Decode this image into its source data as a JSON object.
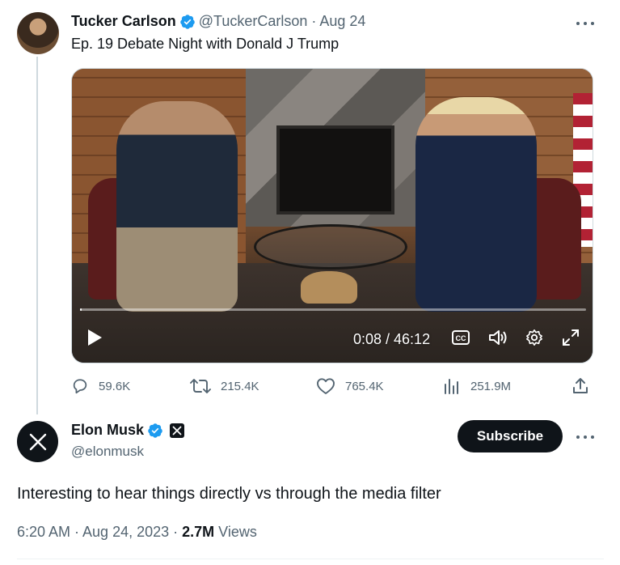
{
  "quoted_tweet": {
    "author_name": "Tucker Carlson",
    "handle_date": "@TuckerCarlson · Aug 24",
    "text": "Ep. 19  Debate Night with Donald J Trump",
    "video": {
      "time_display": "0:08 / 46:12",
      "progress": 0.003
    },
    "stats": {
      "replies": "59.6K",
      "reposts": "215.4K",
      "likes": "765.4K",
      "views": "251.9M"
    }
  },
  "main_tweet": {
    "author_name": "Elon Musk",
    "handle": "@elonmusk",
    "subscribe_label": "Subscribe",
    "text": "Interesting to hear things directly vs through the media filter",
    "timestamp": "6:20 AM · Aug 24, 2023 · ",
    "views_count": "2.7M",
    "views_label": " Views"
  },
  "colors": {
    "verified_blue": "#1d9bf0",
    "secondary_text": "#536471",
    "primary_text": "#0f1419"
  }
}
